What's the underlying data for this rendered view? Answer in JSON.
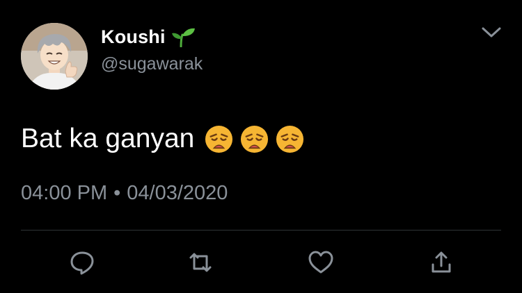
{
  "author": {
    "display_name": "Koushi",
    "handle": "@sugawarak",
    "name_emoji": "sprout-icon"
  },
  "tweet": {
    "text": "Bat ka ganyan",
    "emojis": [
      "weary-face-icon",
      "weary-face-icon",
      "weary-face-icon"
    ],
    "time": "04:00 PM",
    "separator": "•",
    "date": "04/03/2020"
  },
  "actions": [
    "reply-icon",
    "retweet-icon",
    "like-icon",
    "share-icon"
  ],
  "colors": {
    "background": "#000000",
    "text": "#ffffff",
    "secondary_text": "#8a9199",
    "divider": "#2f3336",
    "sprout": "#4fae3c",
    "emoji_yellow": "#f6b533"
  }
}
